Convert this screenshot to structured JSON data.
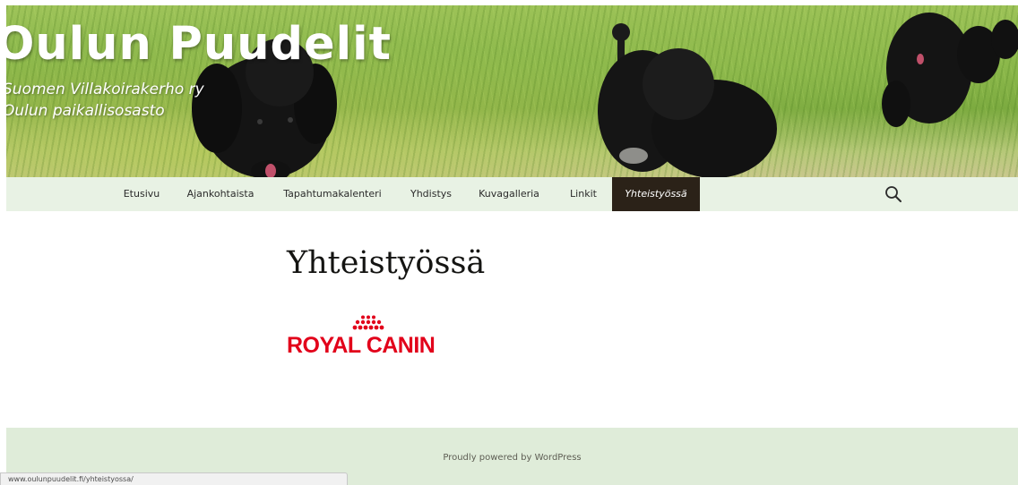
{
  "header": {
    "site_title": "Oulun Puudelit",
    "site_description_line1": "Suomen Villakoirakerho ry",
    "site_description_line2": "Oulun paikallisosasto"
  },
  "nav": {
    "items": [
      {
        "label": "Etusivu"
      },
      {
        "label": "Ajankohtaista"
      },
      {
        "label": "Tapahtumakalenteri"
      },
      {
        "label": "Yhdistys"
      },
      {
        "label": "Kuvagalleria"
      },
      {
        "label": "Linkit"
      },
      {
        "label": "Yhteistyössä",
        "active": true
      }
    ],
    "search_icon": "search-icon"
  },
  "main": {
    "page_title": "Yhteistyössä",
    "sponsor_logo_text": "ROYAL CANIN",
    "sponsor_logo_icon": "crown-icon"
  },
  "footer": {
    "credit": "Proudly powered by WordPress"
  },
  "status_bar": {
    "url": "www.oulunpuudelit.fi/yhteistyossa/"
  },
  "colors": {
    "nav_background": "#e8f2e4",
    "nav_active": "#2b2218",
    "footer_background": "#dfecd9",
    "brand_red": "#e2001a"
  }
}
